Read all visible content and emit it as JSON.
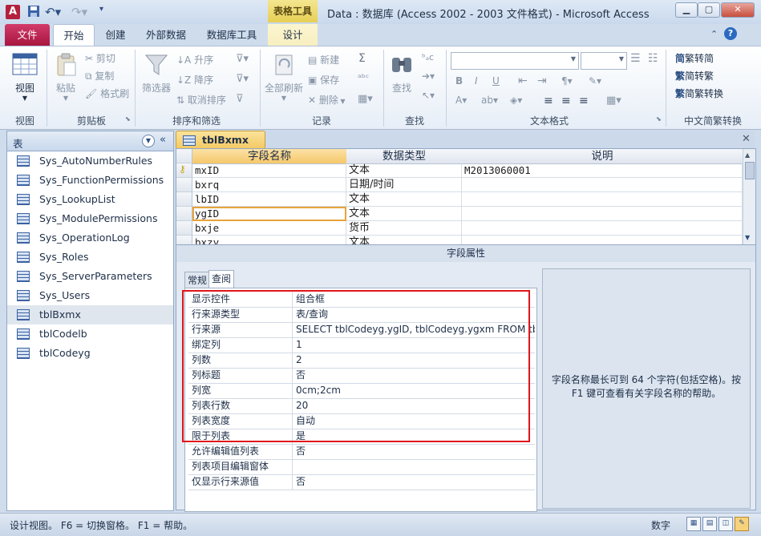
{
  "window": {
    "title": "Data : 数据库 (Access 2002 - 2003 文件格式) - Microsoft Access",
    "context_tab": "表格工具"
  },
  "tabs": {
    "file": "文件",
    "home": "开始",
    "create": "创建",
    "external": "外部数据",
    "dbtools": "数据库工具",
    "design": "设计"
  },
  "ribbon": {
    "groups": {
      "views": "视图",
      "clipboard": "剪贴板",
      "sort_filter": "排序和筛选",
      "records": "记录",
      "find": "查找",
      "text_format": "文本格式",
      "chinese": "中文简繁转换"
    },
    "view_label": "视图",
    "paste_label": "粘贴",
    "cut_label": "剪切",
    "copy_label": "复制",
    "format_painter_label": "格式刷",
    "filter_label": "筛选器",
    "asc_label": "升序",
    "desc_label": "降序",
    "clear_sort_label": "取消排序",
    "refresh_all_label": "全部刷新",
    "new_label": "新建",
    "save_label": "保存",
    "delete_label": "删除",
    "find_label": "查找",
    "trad_to_simp_label": "繁转简",
    "simp_to_trad_label": "简转繁",
    "simp_trad_convert_label": "简繁转换"
  },
  "nav": {
    "title": "表",
    "items": [
      "Sys_AutoNumberRules",
      "Sys_FunctionPermissions",
      "Sys_LookupList",
      "Sys_ModulePermissions",
      "Sys_OperationLog",
      "Sys_Roles",
      "Sys_ServerParameters",
      "Sys_Users",
      "tblBxmx",
      "tblCodelb",
      "tblCodeyg"
    ]
  },
  "document": {
    "tab_label": "tblBxmx",
    "columns": [
      "字段名称",
      "数据类型",
      "说明"
    ],
    "rows": [
      {
        "name": "mxID",
        "type": "文本",
        "desc": "M2013060001"
      },
      {
        "name": "bxrq",
        "type": "日期/时间",
        "desc": ""
      },
      {
        "name": "lbID",
        "type": "文本",
        "desc": ""
      },
      {
        "name": "ygID",
        "type": "文本",
        "desc": ""
      },
      {
        "name": "bxje",
        "type": "货币",
        "desc": ""
      },
      {
        "name": "bxzy",
        "type": "文本",
        "desc": ""
      }
    ]
  },
  "properties": {
    "header": "字段属性",
    "tab_general": "常规",
    "tab_lookup": "查阅",
    "rows": [
      {
        "name": "显示控件",
        "value": "组合框"
      },
      {
        "name": "行来源类型",
        "value": "表/查询"
      },
      {
        "name": "行来源",
        "value": "SELECT tblCodeyg.ygID, tblCodeyg.ygxm FROM tblCodeyg;"
      },
      {
        "name": "绑定列",
        "value": "1"
      },
      {
        "name": "列数",
        "value": "2"
      },
      {
        "name": "列标题",
        "value": "否"
      },
      {
        "name": "列宽",
        "value": "0cm;2cm"
      },
      {
        "name": "列表行数",
        "value": "20"
      },
      {
        "name": "列表宽度",
        "value": "自动"
      },
      {
        "name": "限于列表",
        "value": "是"
      },
      {
        "name": "允许编辑值列表",
        "value": "否"
      },
      {
        "name": "列表项目编辑窗体",
        "value": ""
      },
      {
        "name": "仅显示行来源值",
        "value": "否"
      }
    ],
    "help": "字段名称最长可到 64 个字符(包括空格)。按 F1 键可查看有关字段名称的帮助。"
  },
  "status": {
    "left": "设计视图。 F6 = 切换窗格。 F1 = 帮助。",
    "right": "数字"
  },
  "colors": {
    "file_tab": "#b8194a",
    "context_tab": "#e9d35e",
    "highlight_border": "#e0141b",
    "selected_cell": "#e8a33a"
  }
}
